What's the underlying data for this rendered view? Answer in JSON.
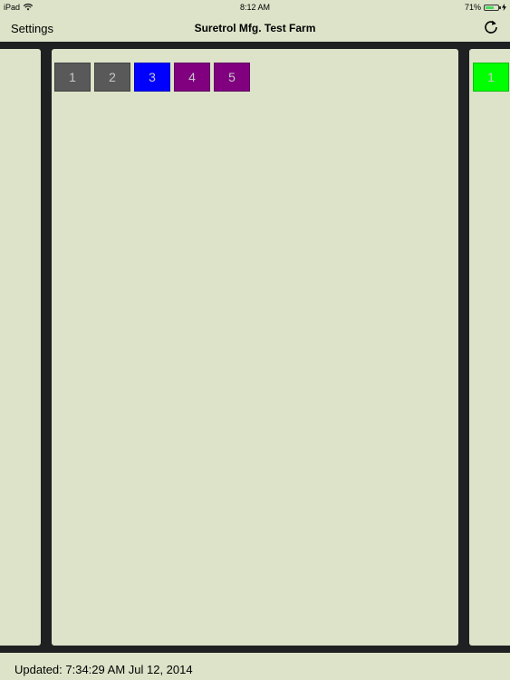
{
  "status_bar": {
    "device": "iPad",
    "time": "8:12 AM",
    "battery_percent": "71%",
    "battery_level": 0.71,
    "wifi_icon": "wifi-icon",
    "battery_icon": "battery-icon",
    "charging_icon": "charging-bolt-icon"
  },
  "nav": {
    "settings_label": "Settings",
    "title": "Suretrol Mfg. Test Farm",
    "refresh_icon": "refresh-icon"
  },
  "panels": {
    "center": {
      "buttons": [
        {
          "label": "1",
          "color": "#595959"
        },
        {
          "label": "2",
          "color": "#595959"
        },
        {
          "label": "3",
          "color": "#0000ff"
        },
        {
          "label": "4",
          "color": "#800080"
        },
        {
          "label": "5",
          "color": "#800080"
        }
      ]
    },
    "right": {
      "buttons": [
        {
          "label": "1",
          "color": "#00ff00"
        }
      ]
    }
  },
  "colors": {
    "background": "#dce3c8",
    "divider": "#1e2022",
    "gray": "#595959",
    "blue": "#0000ff",
    "purple": "#800080",
    "green": "#00ff00"
  },
  "footer": {
    "updated_text": "Updated: 7:34:29 AM Jul 12, 2014"
  }
}
